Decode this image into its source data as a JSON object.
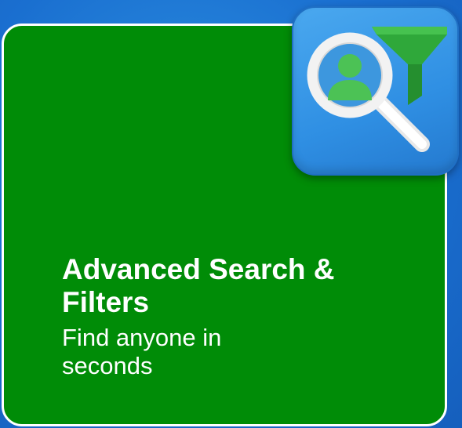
{
  "feature": {
    "title": "Advanced Search & Filters",
    "subtitle": "Find anyone in seconds"
  },
  "icon": {
    "name": "search-user-filter-icon"
  },
  "colors": {
    "background": "#1a6fd0",
    "card": "#008c07",
    "card_border": "#ffffff",
    "icon_background": "#3a9be8",
    "accent_green": "#3cb043"
  }
}
